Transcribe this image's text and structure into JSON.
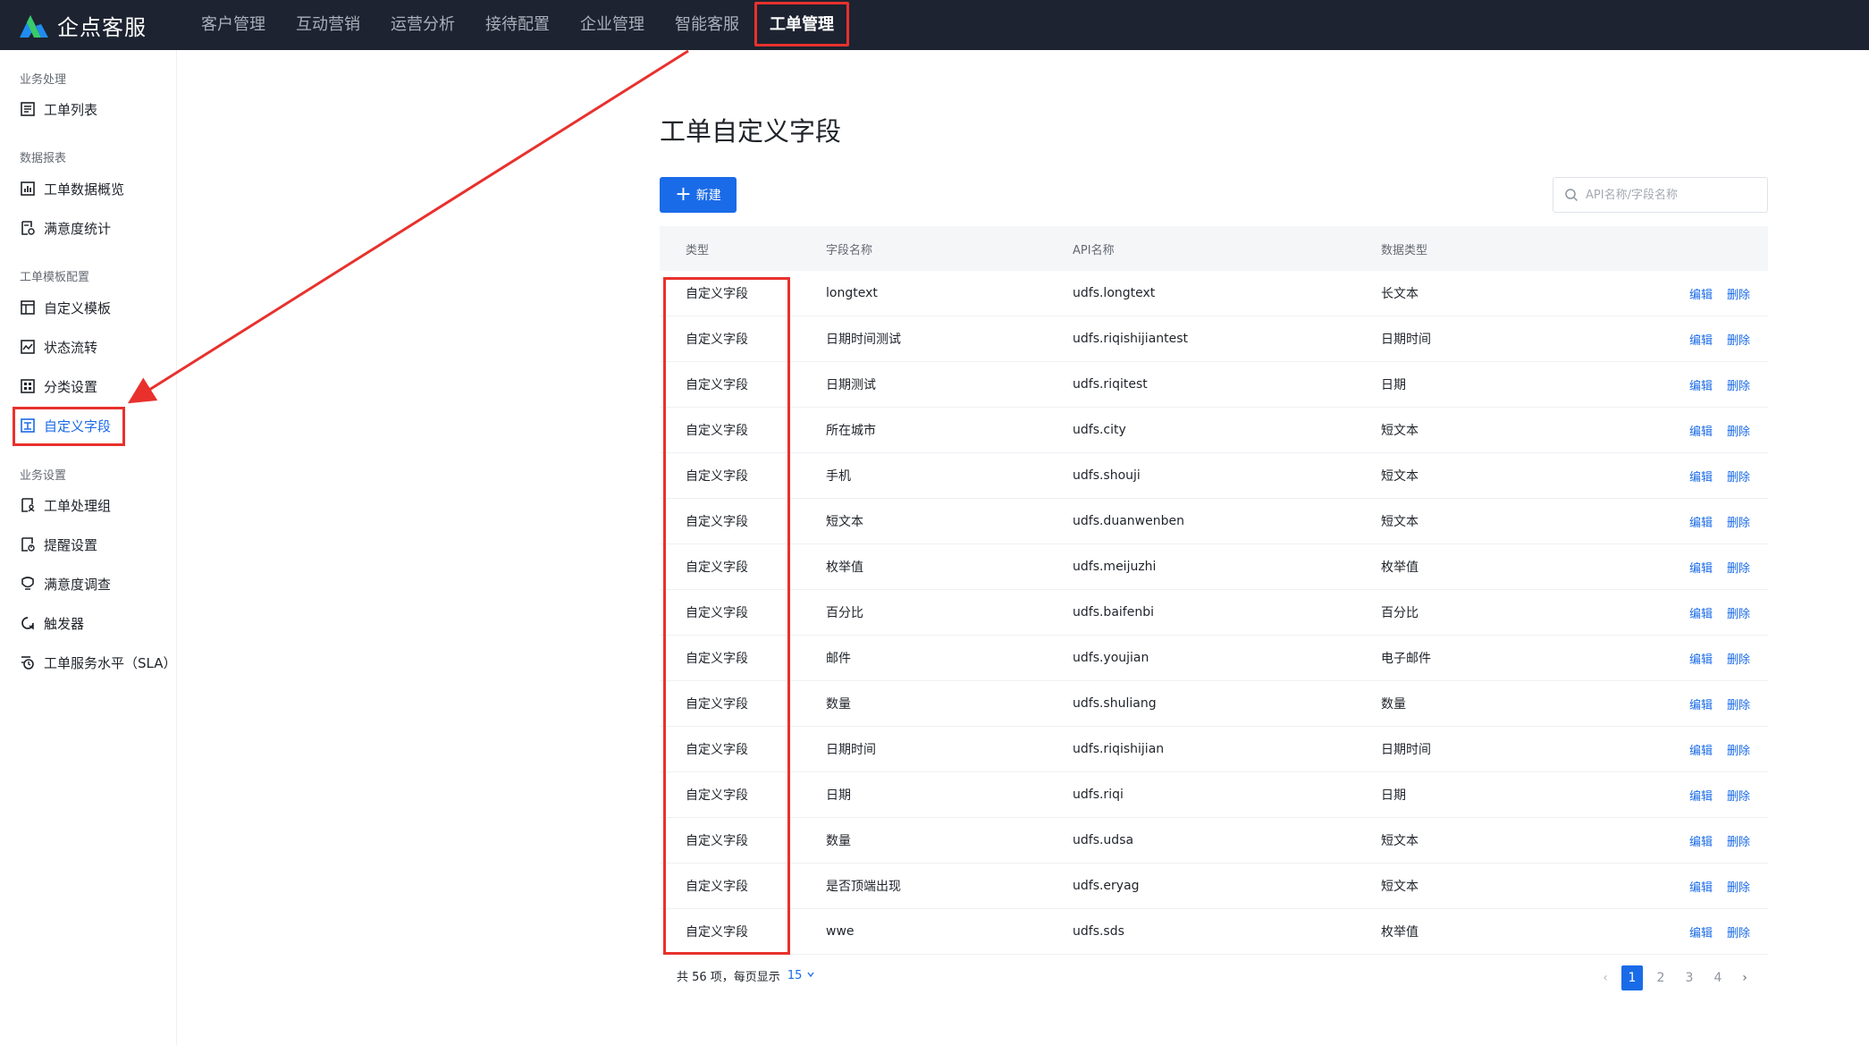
{
  "brand": {
    "name": "企点客服"
  },
  "nav": [
    {
      "label": "客户管理",
      "active": false
    },
    {
      "label": "互动营销",
      "active": false
    },
    {
      "label": "运营分析",
      "active": false
    },
    {
      "label": "接待配置",
      "active": false
    },
    {
      "label": "企业管理",
      "active": false
    },
    {
      "label": "智能客服",
      "active": false
    },
    {
      "label": "工单管理",
      "active": true
    }
  ],
  "sidebar": {
    "groups": [
      {
        "title": "业务处理",
        "items": [
          {
            "label": "工单列表",
            "icon": "list-icon"
          }
        ]
      },
      {
        "title": "数据报表",
        "items": [
          {
            "label": "工单数据概览",
            "icon": "chart-icon"
          },
          {
            "label": "满意度统计",
            "icon": "satisfaction-stat-icon"
          }
        ]
      },
      {
        "title": "工单模板配置",
        "items": [
          {
            "label": "自定义模板",
            "icon": "template-icon"
          },
          {
            "label": "状态流转",
            "icon": "flow-icon"
          },
          {
            "label": "分类设置",
            "icon": "category-icon"
          },
          {
            "label": "自定义字段",
            "icon": "field-icon",
            "active": true
          }
        ]
      },
      {
        "title": "业务设置",
        "items": [
          {
            "label": "工单处理组",
            "icon": "group-icon"
          },
          {
            "label": "提醒设置",
            "icon": "reminder-icon"
          },
          {
            "label": "满意度调查",
            "icon": "survey-icon"
          },
          {
            "label": "触发器",
            "icon": "trigger-icon"
          },
          {
            "label": "工单服务水平（SLA）",
            "icon": "sla-icon"
          }
        ]
      }
    ]
  },
  "main": {
    "title": "工单自定义字段",
    "new_button": "新建",
    "search_placeholder": "API名称/字段名称"
  },
  "table": {
    "columns": [
      "类型",
      "字段名称",
      "API名称",
      "数据类型"
    ],
    "actions": {
      "edit": "编辑",
      "delete": "删除"
    },
    "rows": [
      {
        "type": "自定义字段",
        "name": "longtext",
        "api": "udfs.longtext",
        "dtype": "长文本"
      },
      {
        "type": "自定义字段",
        "name": "日期时间测试",
        "api": "udfs.riqishijiantest",
        "dtype": "日期时间"
      },
      {
        "type": "自定义字段",
        "name": "日期测试",
        "api": "udfs.riqitest",
        "dtype": "日期"
      },
      {
        "type": "自定义字段",
        "name": "所在城市",
        "api": "udfs.city",
        "dtype": "短文本"
      },
      {
        "type": "自定义字段",
        "name": "手机",
        "api": "udfs.shouji",
        "dtype": "短文本"
      },
      {
        "type": "自定义字段",
        "name": "短文本",
        "api": "udfs.duanwenben",
        "dtype": "短文本"
      },
      {
        "type": "自定义字段",
        "name": "枚举值",
        "api": "udfs.meijuzhi",
        "dtype": "枚举值"
      },
      {
        "type": "自定义字段",
        "name": "百分比",
        "api": "udfs.baifenbi",
        "dtype": "百分比"
      },
      {
        "type": "自定义字段",
        "name": "邮件",
        "api": "udfs.youjian",
        "dtype": "电子邮件"
      },
      {
        "type": "自定义字段",
        "name": "数量",
        "api": "udfs.shuliang",
        "dtype": "数量"
      },
      {
        "type": "自定义字段",
        "name": "日期时间",
        "api": "udfs.riqishijian",
        "dtype": "日期时间"
      },
      {
        "type": "自定义字段",
        "name": "日期",
        "api": "udfs.riqi",
        "dtype": "日期"
      },
      {
        "type": "自定义字段",
        "name": "数量",
        "api": "udfs.udsa",
        "dtype": "短文本"
      },
      {
        "type": "自定义字段",
        "name": "是否顶端出现",
        "api": "udfs.eryag",
        "dtype": "短文本"
      },
      {
        "type": "自定义字段",
        "name": "wwe",
        "api": "udfs.sds",
        "dtype": "枚举值"
      }
    ]
  },
  "footer": {
    "total_text": "共 56 项，每页显示",
    "page_size": "15"
  },
  "pagination": {
    "pages": [
      "1",
      "2",
      "3",
      "4"
    ],
    "current": "1"
  },
  "colors": {
    "accent": "#1a6be8",
    "topbar": "#1d2330",
    "annotation": "#e8312d"
  }
}
